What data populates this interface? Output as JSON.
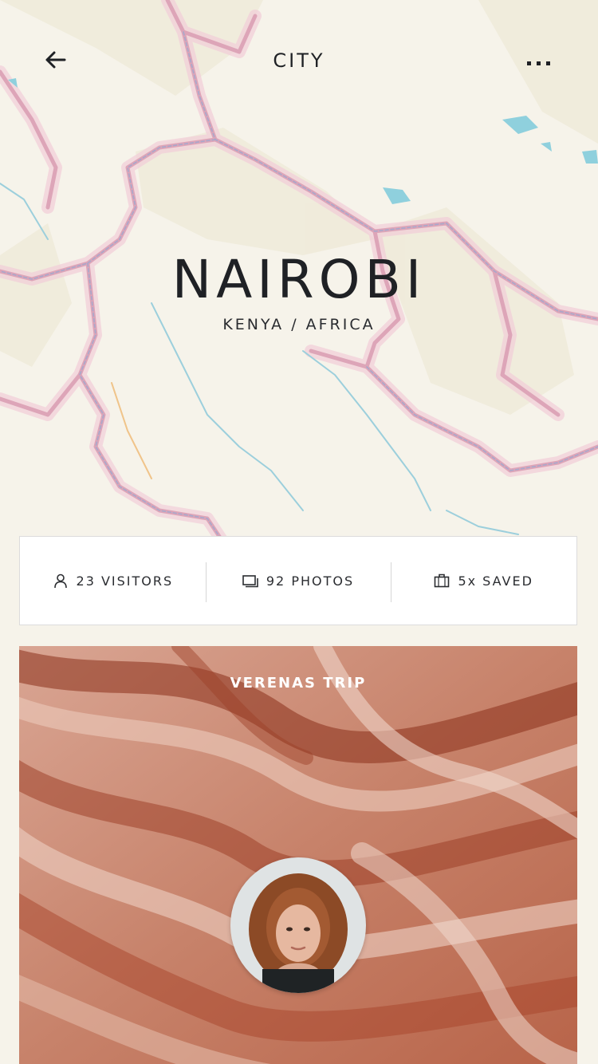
{
  "header": {
    "title": "CITY",
    "back_icon": "arrow-left-icon",
    "more_icon": "more-horizontal-icon"
  },
  "hero": {
    "city": "NAIROBI",
    "location": "KENYA / AFRICA"
  },
  "stats": [
    {
      "icon": "user-icon",
      "label": "23 VISITORS"
    },
    {
      "icon": "photos-icon",
      "label": "92 PHOTOS"
    },
    {
      "icon": "briefcase-icon",
      "label": "5x SAVED"
    }
  ],
  "trip": {
    "title": "VERENAS TRIP",
    "avatar": "avatar-photo"
  },
  "colors": {
    "map_background": "#f6f3ea",
    "border_pink": "#e6b2c4",
    "river_blue": "#8cc7d6",
    "text_dark": "#1f2125",
    "card_rust": "#b9654a"
  }
}
